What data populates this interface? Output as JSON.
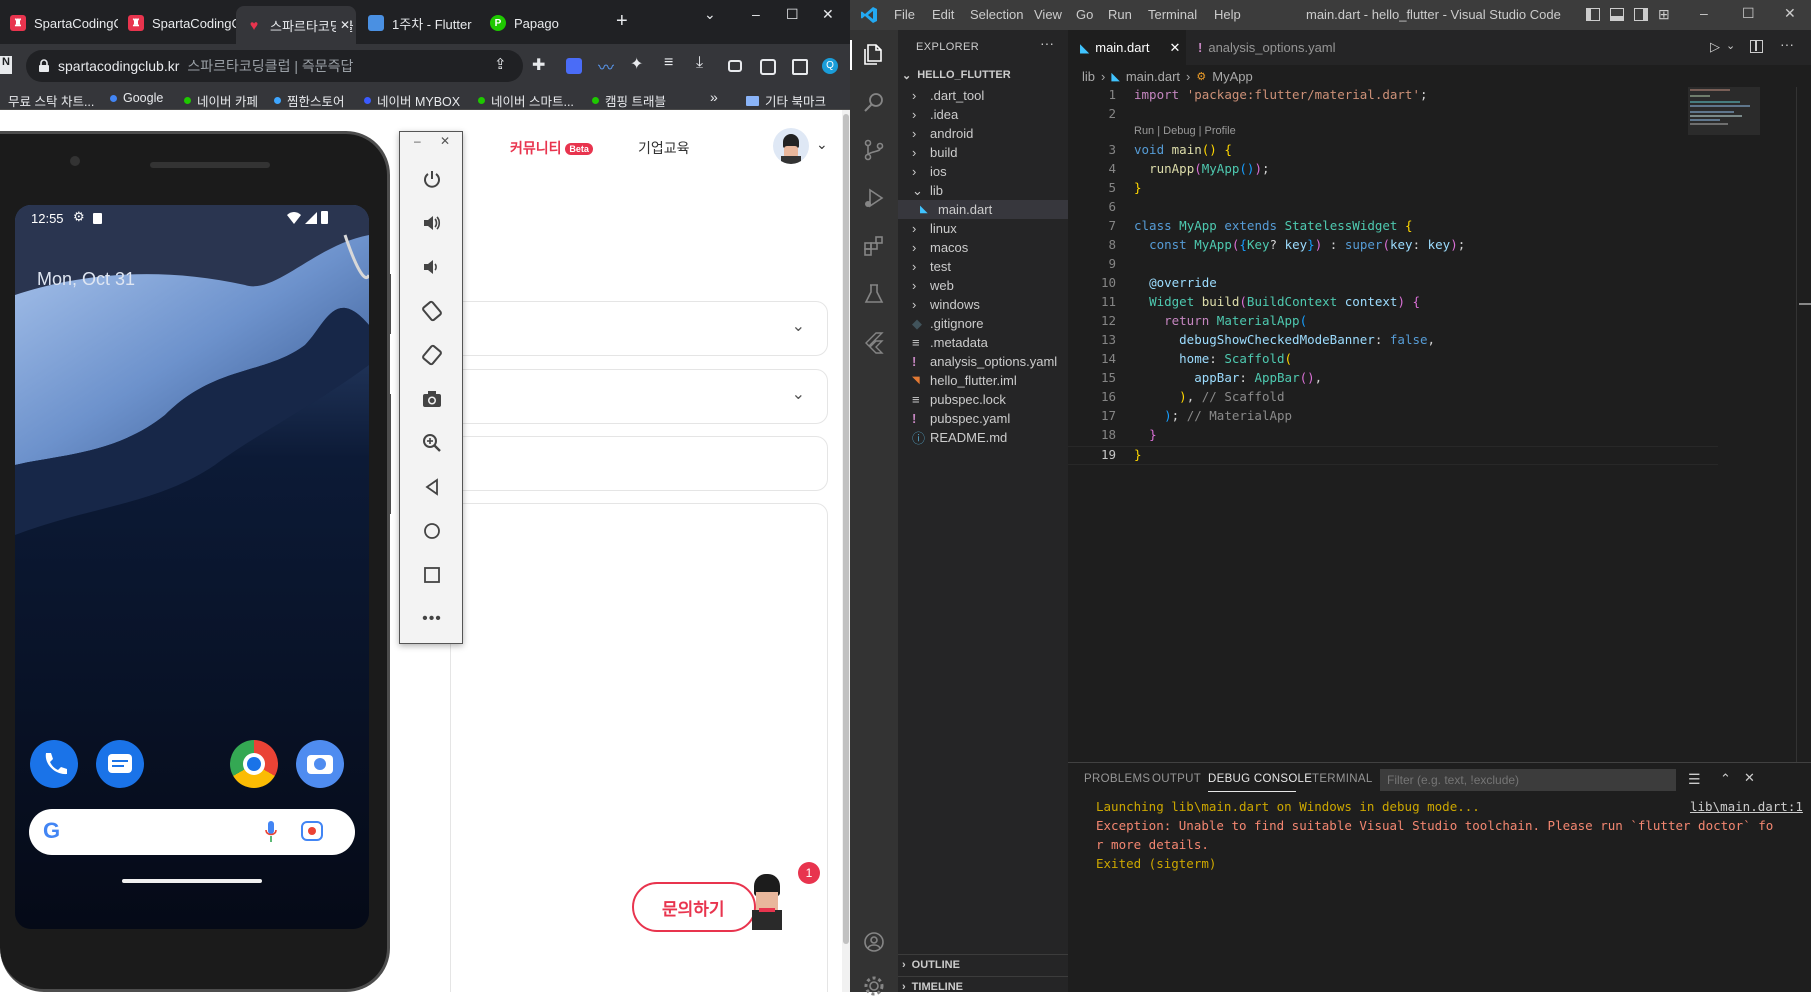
{
  "chrome": {
    "tabs": [
      {
        "label": "SpartaCodingC",
        "fav": "sparta-logo-icon",
        "color": "#e8344e"
      },
      {
        "label": "SpartaCodingC",
        "fav": "sparta-logo-icon",
        "color": "#e8344e"
      },
      {
        "label": "스파르타코딩클",
        "fav": "heart-logo-icon",
        "color": "#e8344e"
      },
      {
        "label": "1주차 - Flutter",
        "fav": "document-icon",
        "color": "#4a90e2"
      },
      {
        "label": "Papago",
        "fav": "papago-icon",
        "color": "#1ec800"
      }
    ],
    "new_tab": "+",
    "url_domain": "spartacodingclub.kr",
    "url_title": "스파르타코딩클럽 | 즉문즉답",
    "profile_initial": "Q",
    "bookmarks": [
      {
        "label": "무료 스탁 차트...",
        "color": "#e8eaed"
      },
      {
        "label": "Google",
        "color": "#4285f4"
      },
      {
        "label": "네이버 카페",
        "color": "#1ec800"
      },
      {
        "label": "찜한스토어",
        "color": "#3ea6ff"
      },
      {
        "label": "네이버 MYBOX",
        "color": "#3b5bff"
      },
      {
        "label": "네이버 스마트...",
        "color": "#1ec800"
      },
      {
        "label": "캠핑 트래블",
        "color": "#1ec800"
      }
    ],
    "bookmarks_overflow": "»",
    "other_bookmarks": "기타 북마크"
  },
  "webpage": {
    "nav_community": "커뮤니티",
    "nav_beta": "Beta",
    "nav_corporate": "기업교육",
    "inquiry_button": "문의하기",
    "notification_count": "1"
  },
  "emulator": {
    "status_time": "12:55",
    "date": "Mon, Oct 31",
    "controls": [
      "power-icon",
      "volume-up-icon",
      "volume-down-icon",
      "rotate-left-icon",
      "rotate-right-icon",
      "camera-icon",
      "zoom-icon",
      "back-icon",
      "home-icon",
      "overview-icon",
      "more-icon"
    ]
  },
  "vscode": {
    "title": "main.dart - hello_flutter - Visual Studio Code",
    "menu": [
      "File",
      "Edit",
      "Selection",
      "View",
      "Go",
      "Run",
      "Terminal",
      "Help"
    ],
    "explorer_title": "EXPLORER",
    "project": "HELLO_FLUTTER",
    "tree": [
      {
        "label": ".dart_tool",
        "type": "folder",
        "indent": 1
      },
      {
        "label": ".idea",
        "type": "folder",
        "indent": 1
      },
      {
        "label": "android",
        "type": "folder",
        "indent": 1
      },
      {
        "label": "build",
        "type": "folder",
        "indent": 1
      },
      {
        "label": "ios",
        "type": "folder",
        "indent": 1
      },
      {
        "label": "lib",
        "type": "folder-open",
        "indent": 1
      },
      {
        "label": "main.dart",
        "type": "dart",
        "indent": 2
      },
      {
        "label": "linux",
        "type": "folder",
        "indent": 1
      },
      {
        "label": "macos",
        "type": "folder",
        "indent": 1
      },
      {
        "label": "test",
        "type": "folder",
        "indent": 1
      },
      {
        "label": "web",
        "type": "folder",
        "indent": 1
      },
      {
        "label": "windows",
        "type": "folder",
        "indent": 1
      },
      {
        "label": ".gitignore",
        "type": "git",
        "indent": 1
      },
      {
        "label": ".metadata",
        "type": "lines",
        "indent": 1
      },
      {
        "label": "analysis_options.yaml",
        "type": "yaml",
        "indent": 1
      },
      {
        "label": "hello_flutter.iml",
        "type": "rss",
        "indent": 1
      },
      {
        "label": "pubspec.lock",
        "type": "lines",
        "indent": 1
      },
      {
        "label": "pubspec.yaml",
        "type": "yaml",
        "indent": 1
      },
      {
        "label": "README.md",
        "type": "info",
        "indent": 1
      }
    ],
    "outline": "OUTLINE",
    "timeline": "TIMELINE",
    "tabs": [
      {
        "label": "main.dart",
        "active": true
      },
      {
        "label": "analysis_options.yaml",
        "active": false
      }
    ],
    "breadcrumb": [
      "lib",
      "main.dart",
      "MyApp"
    ],
    "codelens": "Run | Debug | Profile",
    "panel_tabs": [
      "PROBLEMS",
      "OUTPUT",
      "DEBUG CONSOLE",
      "TERMINAL"
    ],
    "filter_placeholder": "Filter (e.g. text, !exclude)",
    "console": [
      {
        "text": "Launching lib\\main.dart on Windows in debug mode...",
        "color": "#cca700"
      },
      {
        "text": "Exception: Unable to find suitable Visual Studio toolchain. Please run `flutter doctor` fo",
        "color": "#f48771"
      },
      {
        "text": "r more details.",
        "color": "#f48771"
      },
      {
        "text": "Exited (sigterm)",
        "color": "#cca700"
      }
    ],
    "console_link": "lib\\main.dart:1"
  }
}
